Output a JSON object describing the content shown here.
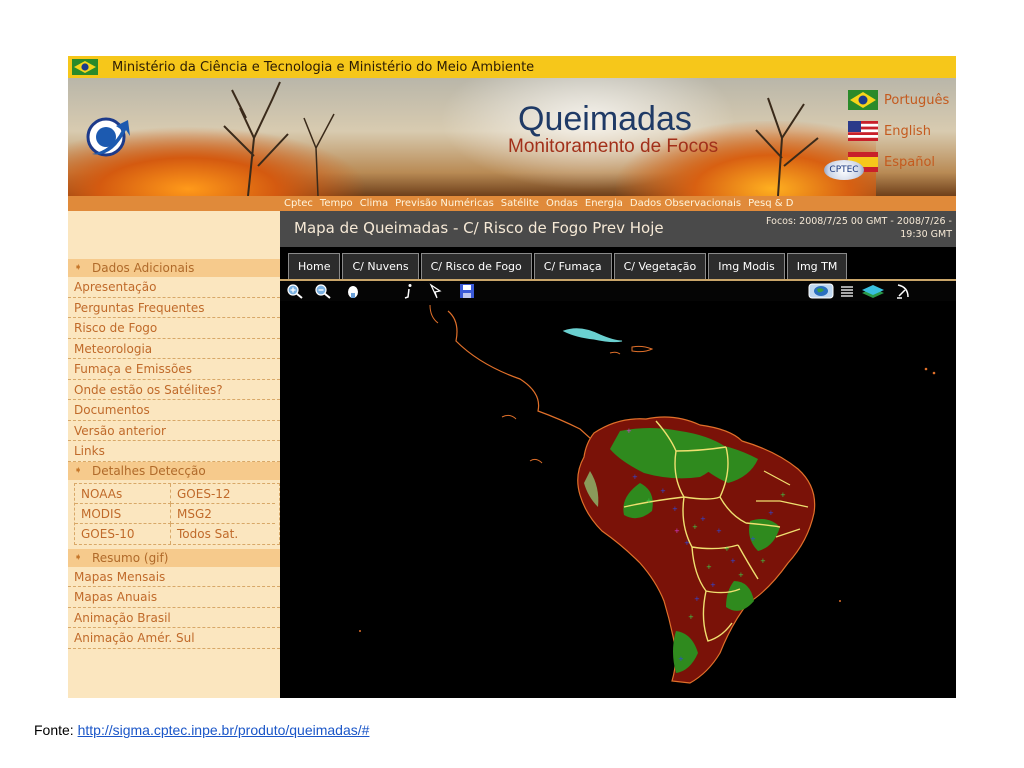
{
  "header": {
    "ministries": "Ministério da Ciência e Tecnologia  e  Ministério do Meio Ambiente",
    "title": "Queimadas",
    "subtitle": "Monitoramento de Focos",
    "cptec_logo": "CPTEC",
    "languages": [
      "Português",
      "English",
      "Español"
    ]
  },
  "nav": {
    "links": [
      "Cptec",
      "Tempo",
      "Clima",
      "Previsão Numéricas",
      "Satélite",
      "Ondas",
      "Energia",
      "Dados Observacionais",
      "Pesq & D"
    ]
  },
  "sidebar": {
    "section1": {
      "title": "Dados Adicionais",
      "items": [
        "Apresentação",
        "Perguntas Frequentes",
        "Risco de Fogo",
        "Meteorologia",
        "Fumaça e Emissões",
        "Onde estão os Satélites?",
        "Documentos",
        "Versão anterior",
        "Links"
      ]
    },
    "section2": {
      "title": "Detalhes Detecção",
      "satellites": [
        "NOAAs",
        "GOES-12",
        "MODIS",
        "MSG2",
        "GOES-10",
        "Todos Sat."
      ]
    },
    "section3": {
      "title": "Resumo (gif)",
      "items": [
        "Mapas Mensais",
        "Mapas Anuais",
        "Animação Brasil",
        "Animação Amér. Sul"
      ]
    }
  },
  "main": {
    "map_title": "Mapa de Queimadas - C/ Risco de Fogo Prev Hoje",
    "focos_line1": "Focos: 2008/7/25 00 GMT - 2008/7/26 -",
    "focos_line2": "19:30 GMT",
    "tabs": [
      "Home",
      "C/ Nuvens",
      "C/ Risco de Fogo",
      "C/ Fumaça",
      "C/ Vegetação",
      "Img Modis",
      "Img TM"
    ],
    "tools": [
      "zoom-in-icon",
      "zoom-out-icon",
      "pan-hand-icon",
      "info-icon",
      "select-icon",
      "save-icon",
      "globe-icon",
      "list-icon",
      "layers-icon",
      "satellite-icon"
    ]
  },
  "colors": {
    "topbar": "#f6c71a",
    "nav_orange": "#e08a3a",
    "sidebar_bg": "#fbe6bf",
    "sidebar_text": "#c06a2a",
    "map_bg": "#000000",
    "risk_high": "#7a1208",
    "vegetation": "#2f8a1e",
    "borders": "#f0e070",
    "coast": "#e0702a"
  },
  "footer": {
    "label": "Fonte: ",
    "url": "http://sigma.cptec.inpe.br/produto/queimadas/#"
  }
}
